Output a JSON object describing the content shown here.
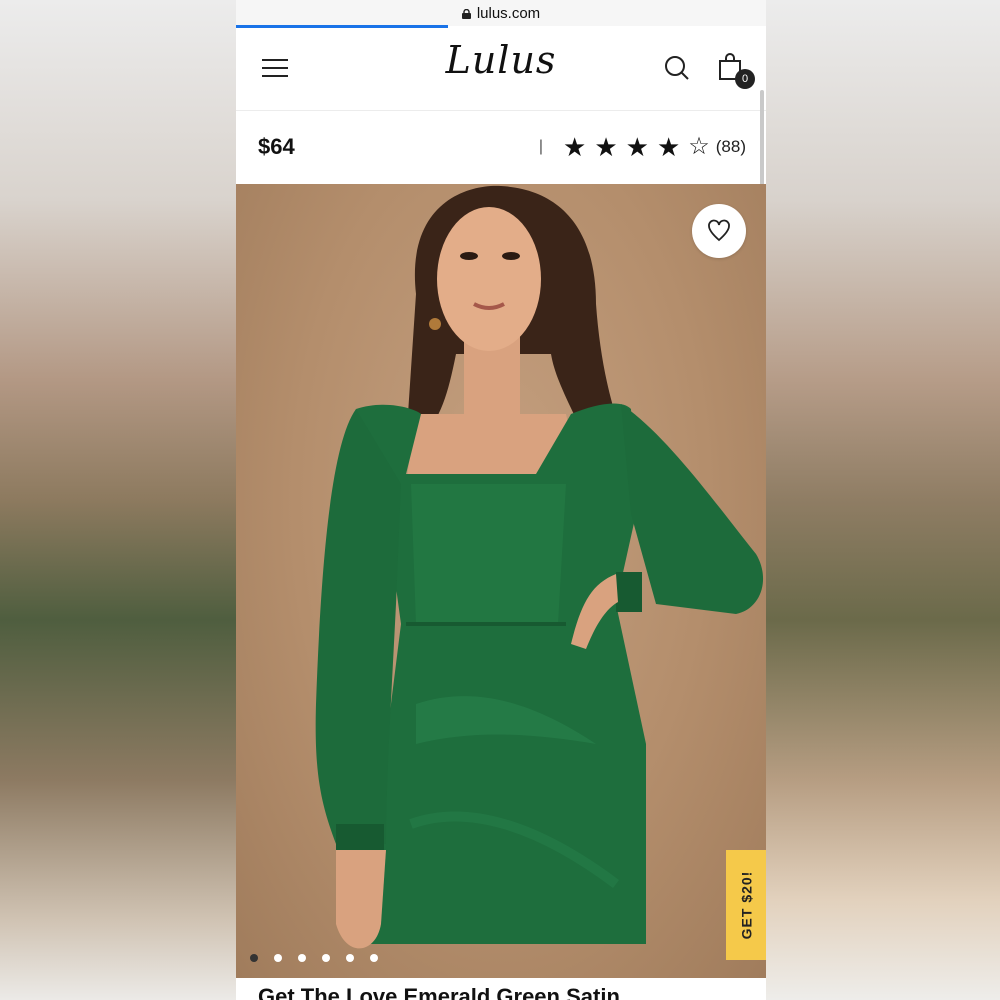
{
  "browser": {
    "url": "lulus.com",
    "load_progress_percent": 40
  },
  "header": {
    "logo": "Lulus",
    "cart_count": "0"
  },
  "product": {
    "price": "$64",
    "rating_separator": "|",
    "stars_filled": 4,
    "stars_total": 5,
    "review_count": "(88)",
    "title": "Get The Love Emerald Green Satin"
  },
  "gallery": {
    "image_count": 6,
    "active_index": 0
  },
  "promo": {
    "label": "GET $20!"
  },
  "icons": [
    "lock-icon",
    "hamburger-icon",
    "search-icon",
    "shopping-bag-icon",
    "star-icon",
    "heart-icon"
  ],
  "colors": {
    "progress": "#1a73e8",
    "promo": "#f5c94a",
    "dress": "#1e6e3d",
    "backdrop": "#b48e6c"
  }
}
